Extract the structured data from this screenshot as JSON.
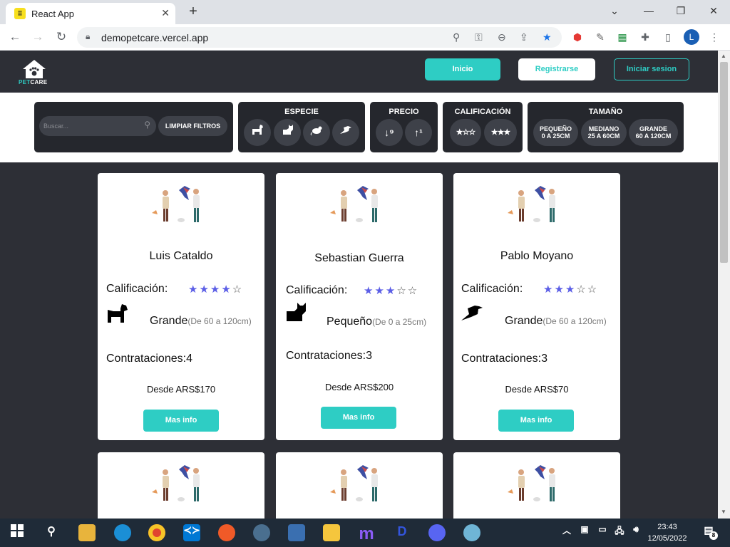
{
  "browser": {
    "tab_title": "React App",
    "url": "demopetcare.vercel.app",
    "profile_initial": "L"
  },
  "navbar": {
    "logo_text_a": "PET",
    "logo_text_b": "CARE",
    "inicio": "Inicio",
    "registrarse": "Registrarse",
    "iniciar_sesion": "Iniciar sesion"
  },
  "filters": {
    "search_placeholder": "Buscar...",
    "clear_label": "LIMPIAR FILTROS",
    "especie_title": "ESPECIE",
    "precio_title": "PRECIO",
    "calificacion_title": "CALIFICACIÓN",
    "rating_low": "★☆☆",
    "rating_high": "★★★",
    "tamano_title": "TAMAÑO",
    "sizes": [
      {
        "name": "PEQUEÑO",
        "range": "0 A 25CM"
      },
      {
        "name": "MEDIANO",
        "range": "25 A 60CM"
      },
      {
        "name": "GRANDE",
        "range": "60 A 120CM"
      }
    ]
  },
  "cards": [
    {
      "name": "Luis Cataldo",
      "rating_label": "Calificación:",
      "rating": 4,
      "pet": "dog-icon",
      "size": "Grande",
      "size_range": "(De 60 a 120cm)",
      "contrataciones": "Contrataciones:4",
      "price": "Desde ARS$170",
      "button": "Mas info"
    },
    {
      "name": "Sebastian Guerra",
      "rating_label": "Calificación:",
      "rating": 3,
      "pet": "cat-icon",
      "size": "Pequeño",
      "size_range": "(De 0 a 25cm)",
      "contrataciones": "Contrataciones:3",
      "price": "Desde ARS$200",
      "button": "Mas info"
    },
    {
      "name": "Pablo Moyano",
      "rating_label": "Calificación:",
      "rating": 3,
      "pet": "bird-icon",
      "size": "Grande",
      "size_range": "(De 60 a 120cm)",
      "contrataciones": "Contrataciones:3",
      "price": "Desde ARS$70",
      "button": "Mas info"
    }
  ],
  "taskbar": {
    "time": "23:43",
    "date": "12/05/2022",
    "notifications": "8"
  },
  "colors": {
    "accent": "#2ecdc4",
    "page_bg": "#2d2f36",
    "star": "#5b5ee6"
  }
}
